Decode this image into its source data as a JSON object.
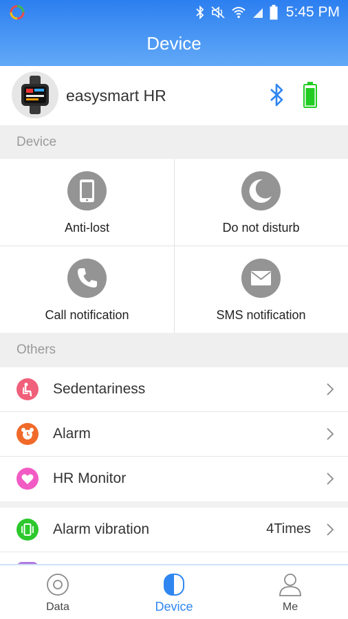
{
  "status_bar": {
    "time": "5:45 PM"
  },
  "app_bar": {
    "title": "Device"
  },
  "device": {
    "name": "easysmart HR"
  },
  "sections": {
    "device": "Device",
    "others": "Others"
  },
  "device_grid": [
    {
      "label": "Anti-lost",
      "icon": "phone-icon"
    },
    {
      "label": "Do not disturb",
      "icon": "moon-icon"
    },
    {
      "label": "Call notification",
      "icon": "call-icon"
    },
    {
      "label": "SMS notification",
      "icon": "envelope-icon"
    }
  ],
  "others_list": [
    {
      "label": "Sedentariness",
      "icon": "sitting-person-icon",
      "color": "#f0607a"
    },
    {
      "label": "Alarm",
      "icon": "alarm-clock-icon",
      "color": "#f06a2a"
    },
    {
      "label": "HR Monitor",
      "icon": "heart-icon",
      "color": "#f25bc4"
    }
  ],
  "vibration_row": {
    "label": "Alarm vibration",
    "value": "4Times",
    "icon": "vibration-icon",
    "color": "#2dc82d"
  },
  "bottom_nav": [
    {
      "label": "Data",
      "icon": "data-icon",
      "active": false
    },
    {
      "label": "Device",
      "icon": "device-icon",
      "active": true
    },
    {
      "label": "Me",
      "icon": "person-icon",
      "active": false
    }
  ],
  "colors": {
    "primary": "#2f86f0",
    "battery": "#22cc22",
    "icon_gray": "#949494"
  }
}
